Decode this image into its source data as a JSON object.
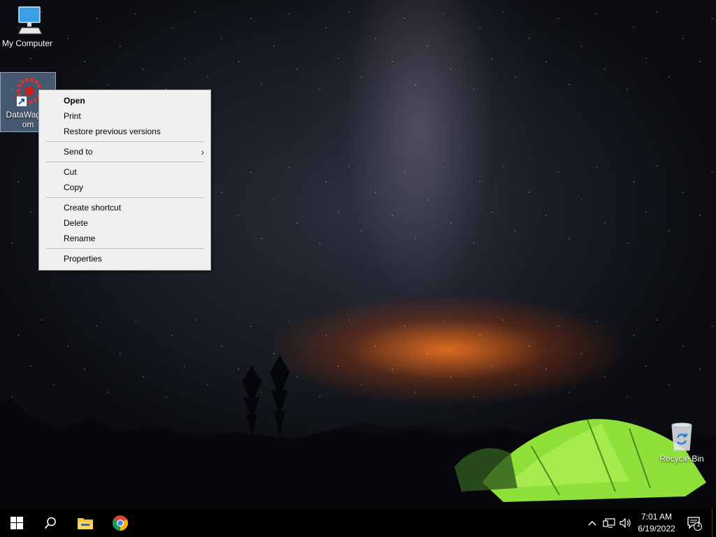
{
  "desktop": {
    "icons": [
      {
        "label": "My Computer",
        "icon": "computer-icon"
      },
      {
        "label": "DataWagon",
        "label_line2": "om",
        "icon": "datawagon-shortcut-icon"
      },
      {
        "label": "Recycle Bin",
        "icon": "recycle-bin-icon"
      }
    ]
  },
  "context_menu": {
    "items": [
      {
        "label": "Open",
        "bold": true
      },
      {
        "label": "Print"
      },
      {
        "label": "Restore previous versions"
      },
      {
        "label": "Send to",
        "submenu": true
      },
      {
        "label": "Cut"
      },
      {
        "label": "Copy"
      },
      {
        "label": "Create shortcut"
      },
      {
        "label": "Delete"
      },
      {
        "label": "Rename"
      },
      {
        "label": "Properties"
      }
    ]
  },
  "taskbar": {
    "pinned": [
      "start-icon",
      "search-icon",
      "file-explorer-icon",
      "chrome-icon"
    ],
    "tray": [
      "chevron-up-icon",
      "network-icon",
      "volume-icon"
    ],
    "clock": {
      "time": "7:01 AM",
      "date": "6/19/2022"
    },
    "notifications": {
      "count": "1"
    }
  },
  "colors": {
    "menu_bg": "#f0f0f0",
    "taskbar_bg": "#000000",
    "tent": "#8fe03a",
    "selection": "#7896be"
  }
}
